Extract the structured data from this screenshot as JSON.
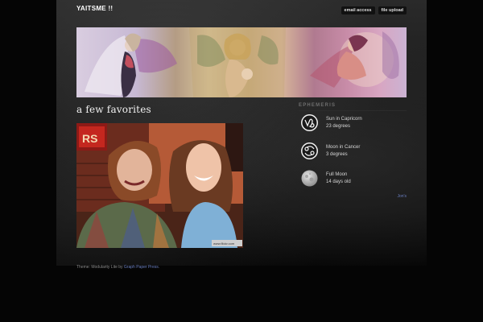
{
  "header": {
    "site_title": "YAITSME !!",
    "nav": [
      "email access",
      "file upload"
    ]
  },
  "post": {
    "title": "a few favorites",
    "photo_sign_text": "RS",
    "photo_watermark": "www.flickr.com"
  },
  "sidebar": {
    "heading": "EPHEMERIS",
    "items": [
      {
        "icon": "capricorn-icon",
        "line1": "Sun in Capricorn",
        "line2": "23 degrees"
      },
      {
        "icon": "cancer-icon",
        "line1": "Moon in Cancer",
        "line2": "3 degrees"
      },
      {
        "icon": "full-moon-icon",
        "line1": "Full Moon",
        "line2": "14 days old"
      }
    ],
    "link": "Jon's"
  },
  "footer": {
    "prefix": "Theme: Modularity Lite by ",
    "link": "Graph Paper Press",
    "suffix": "."
  }
}
